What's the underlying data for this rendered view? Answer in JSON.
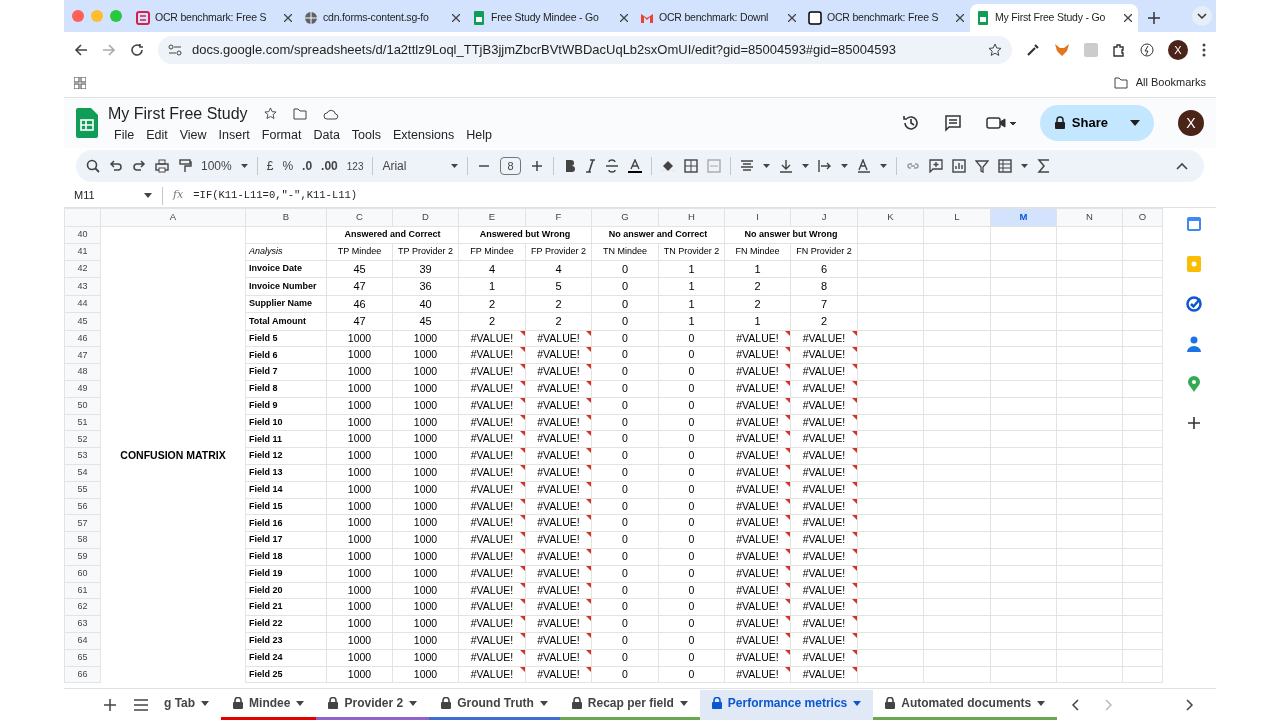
{
  "browser_tabs": [
    {
      "title": "OCR benchmark: Free S",
      "kind": "form",
      "selected": false
    },
    {
      "title": "cdn.forms-content.sg-fo",
      "kind": "web",
      "selected": false
    },
    {
      "title": "Free Study Mindee - Go",
      "kind": "sheets",
      "selected": false
    },
    {
      "title": "OCR benchmark: Downl",
      "kind": "gmail",
      "selected": false
    },
    {
      "title": "OCR benchmark: Free S",
      "kind": "notion",
      "selected": false
    },
    {
      "title": "My First Free Study - Go",
      "kind": "sheets",
      "selected": true
    }
  ],
  "address": "docs.google.com/spreadsheets/d/1a2ttlz9Loql_TTjB3jjmZbcrBVtWBDacUqLb2sxOmUI/edit?gid=85004593#gid=85004593",
  "profile_initial": "X",
  "bookmarks": {
    "label": "All Bookmarks"
  },
  "document": {
    "title": "My First Free Study",
    "menus": [
      "File",
      "Edit",
      "View",
      "Insert",
      "Format",
      "Data",
      "Tools",
      "Extensions",
      "Help"
    ],
    "share_label": "Share",
    "avatar_initial": "X"
  },
  "toolbar": {
    "zoom": "100%",
    "currency": "£",
    "percent": "%",
    "decrease_decimals": ".0",
    "increase_decimals": ".00",
    "number_format": "123",
    "font": "Arial",
    "font_size": "8"
  },
  "formula_bar": {
    "cell": "M11",
    "fx": "fx",
    "formula": "=IF(K11-L11=0,\"-\",K11-L11)"
  },
  "sheet": {
    "columns": [
      {
        "label": "A",
        "selected": false
      },
      {
        "label": "B",
        "selected": false
      },
      {
        "label": "C",
        "selected": false
      },
      {
        "label": "D",
        "selected": false
      },
      {
        "label": "E",
        "selected": false
      },
      {
        "label": "F",
        "selected": false
      },
      {
        "label": "G",
        "selected": false
      },
      {
        "label": "H",
        "selected": false
      },
      {
        "label": "I",
        "selected": false
      },
      {
        "label": "J",
        "selected": false
      },
      {
        "label": "K",
        "selected": false
      },
      {
        "label": "L",
        "selected": false
      },
      {
        "label": "M",
        "selected": true
      },
      {
        "label": "N",
        "selected": false
      },
      {
        "label": "O",
        "selected": false
      }
    ],
    "rows": [
      {
        "number": "40",
        "kind": "group",
        "cells": [
          "",
          "",
          {
            "text": "Answered and Correct",
            "colspan": 2
          },
          {
            "text": "Answered but Wrong",
            "colspan": 2
          },
          {
            "text": "No answer and Correct",
            "colspan": 2
          },
          {
            "text": "No answer but Wrong",
            "colspan": 2
          }
        ]
      },
      {
        "number": "41",
        "kind": "subheader",
        "cells": [
          "",
          "Analysis",
          "TP Mindee",
          "TP Provider 2",
          "FP Mindee",
          "FP Provider 2",
          "TN Mindee",
          "TN Provider 2",
          "FN Mindee",
          "FN Provider 2"
        ]
      },
      {
        "number": "42",
        "kind": "main",
        "cells": [
          "",
          "Invoice Date",
          "45",
          "39",
          "4",
          "4",
          "0",
          "1",
          "1",
          "6"
        ]
      },
      {
        "number": "43",
        "kind": "main",
        "cells": [
          "",
          "Invoice Number",
          "47",
          "36",
          "1",
          "5",
          "0",
          "1",
          "2",
          "8"
        ]
      },
      {
        "number": "44",
        "kind": "main",
        "cells": [
          "",
          "Supplier Name",
          "46",
          "40",
          "2",
          "2",
          "0",
          "1",
          "2",
          "7"
        ]
      },
      {
        "number": "45",
        "kind": "main",
        "cells": [
          "",
          "Total Amount",
          "47",
          "45",
          "2",
          "2",
          "0",
          "1",
          "1",
          "2"
        ]
      },
      {
        "number": "46",
        "kind": "field",
        "cells": [
          "",
          "Field 5",
          "1000",
          "1000",
          "#VALUE!",
          "#VALUE!",
          "0",
          "0",
          "#VALUE!",
          "#VALUE!"
        ],
        "errors": [
          false,
          false,
          false,
          false,
          true,
          true,
          false,
          false,
          true,
          true
        ]
      },
      {
        "number": "47",
        "kind": "field",
        "cells": [
          "",
          "Field 6",
          "1000",
          "1000",
          "#VALUE!",
          "#VALUE!",
          "0",
          "0",
          "#VALUE!",
          "#VALUE!"
        ],
        "errors": [
          false,
          false,
          false,
          false,
          true,
          true,
          false,
          false,
          true,
          true
        ]
      },
      {
        "number": "48",
        "kind": "field",
        "cells": [
          "",
          "Field 7",
          "1000",
          "1000",
          "#VALUE!",
          "#VALUE!",
          "0",
          "0",
          "#VALUE!",
          "#VALUE!"
        ],
        "errors": [
          false,
          false,
          false,
          false,
          true,
          true,
          false,
          false,
          true,
          true
        ]
      },
      {
        "number": "49",
        "kind": "field",
        "cells": [
          "",
          "Field 8",
          "1000",
          "1000",
          "#VALUE!",
          "#VALUE!",
          "0",
          "0",
          "#VALUE!",
          "#VALUE!"
        ],
        "errors": [
          false,
          false,
          false,
          false,
          true,
          true,
          false,
          false,
          true,
          true
        ]
      },
      {
        "number": "50",
        "kind": "field",
        "cells": [
          "",
          "Field 9",
          "1000",
          "1000",
          "#VALUE!",
          "#VALUE!",
          "0",
          "0",
          "#VALUE!",
          "#VALUE!"
        ],
        "errors": [
          false,
          false,
          false,
          false,
          true,
          true,
          false,
          false,
          true,
          true
        ]
      },
      {
        "number": "51",
        "kind": "field",
        "cells": [
          "",
          "Field 10",
          "1000",
          "1000",
          "#VALUE!",
          "#VALUE!",
          "0",
          "0",
          "#VALUE!",
          "#VALUE!"
        ],
        "errors": [
          false,
          false,
          false,
          false,
          true,
          true,
          false,
          false,
          true,
          true
        ]
      },
      {
        "number": "52",
        "kind": "field",
        "cells": [
          "",
          "Field 11",
          "1000",
          "1000",
          "#VALUE!",
          "#VALUE!",
          "0",
          "0",
          "#VALUE!",
          "#VALUE!"
        ],
        "errors": [
          false,
          false,
          false,
          false,
          true,
          true,
          false,
          false,
          true,
          true
        ]
      },
      {
        "number": "53",
        "kind": "field",
        "cells": [
          "CONFUSION MATRIX",
          "Field 12",
          "1000",
          "1000",
          "#VALUE!",
          "#VALUE!",
          "0",
          "0",
          "#VALUE!",
          "#VALUE!"
        ],
        "errors": [
          false,
          false,
          false,
          false,
          true,
          true,
          false,
          false,
          true,
          true
        ]
      },
      {
        "number": "54",
        "kind": "field",
        "cells": [
          "",
          "Field 13",
          "1000",
          "1000",
          "#VALUE!",
          "#VALUE!",
          "0",
          "0",
          "#VALUE!",
          "#VALUE!"
        ],
        "errors": [
          false,
          false,
          false,
          false,
          true,
          true,
          false,
          false,
          true,
          true
        ]
      },
      {
        "number": "55",
        "kind": "field",
        "cells": [
          "",
          "Field 14",
          "1000",
          "1000",
          "#VALUE!",
          "#VALUE!",
          "0",
          "0",
          "#VALUE!",
          "#VALUE!"
        ],
        "errors": [
          false,
          false,
          false,
          false,
          true,
          true,
          false,
          false,
          true,
          true
        ]
      },
      {
        "number": "56",
        "kind": "field",
        "cells": [
          "",
          "Field 15",
          "1000",
          "1000",
          "#VALUE!",
          "#VALUE!",
          "0",
          "0",
          "#VALUE!",
          "#VALUE!"
        ],
        "errors": [
          false,
          false,
          false,
          false,
          true,
          true,
          false,
          false,
          true,
          true
        ]
      },
      {
        "number": "57",
        "kind": "field",
        "cells": [
          "",
          "Field 16",
          "1000",
          "1000",
          "#VALUE!",
          "#VALUE!",
          "0",
          "0",
          "#VALUE!",
          "#VALUE!"
        ],
        "errors": [
          false,
          false,
          false,
          false,
          true,
          true,
          false,
          false,
          true,
          true
        ]
      },
      {
        "number": "58",
        "kind": "field",
        "cells": [
          "",
          "Field 17",
          "1000",
          "1000",
          "#VALUE!",
          "#VALUE!",
          "0",
          "0",
          "#VALUE!",
          "#VALUE!"
        ],
        "errors": [
          false,
          false,
          false,
          false,
          true,
          true,
          false,
          false,
          true,
          true
        ]
      },
      {
        "number": "59",
        "kind": "field",
        "cells": [
          "",
          "Field 18",
          "1000",
          "1000",
          "#VALUE!",
          "#VALUE!",
          "0",
          "0",
          "#VALUE!",
          "#VALUE!"
        ],
        "errors": [
          false,
          false,
          false,
          false,
          true,
          true,
          false,
          false,
          true,
          true
        ]
      },
      {
        "number": "60",
        "kind": "field",
        "cells": [
          "",
          "Field 19",
          "1000",
          "1000",
          "#VALUE!",
          "#VALUE!",
          "0",
          "0",
          "#VALUE!",
          "#VALUE!"
        ],
        "errors": [
          false,
          false,
          false,
          false,
          true,
          true,
          false,
          false,
          true,
          true
        ]
      },
      {
        "number": "61",
        "kind": "field",
        "cells": [
          "",
          "Field 20",
          "1000",
          "1000",
          "#VALUE!",
          "#VALUE!",
          "0",
          "0",
          "#VALUE!",
          "#VALUE!"
        ],
        "errors": [
          false,
          false,
          false,
          false,
          true,
          true,
          false,
          false,
          true,
          true
        ]
      },
      {
        "number": "62",
        "kind": "field",
        "cells": [
          "",
          "Field 21",
          "1000",
          "1000",
          "#VALUE!",
          "#VALUE!",
          "0",
          "0",
          "#VALUE!",
          "#VALUE!"
        ],
        "errors": [
          false,
          false,
          false,
          false,
          true,
          true,
          false,
          false,
          true,
          true
        ]
      },
      {
        "number": "63",
        "kind": "field",
        "cells": [
          "",
          "Field 22",
          "1000",
          "1000",
          "#VALUE!",
          "#VALUE!",
          "0",
          "0",
          "#VALUE!",
          "#VALUE!"
        ],
        "errors": [
          false,
          false,
          false,
          false,
          true,
          true,
          false,
          false,
          true,
          true
        ]
      },
      {
        "number": "64",
        "kind": "field",
        "cells": [
          "",
          "Field 23",
          "1000",
          "1000",
          "#VALUE!",
          "#VALUE!",
          "0",
          "0",
          "#VALUE!",
          "#VALUE!"
        ],
        "errors": [
          false,
          false,
          false,
          false,
          true,
          true,
          false,
          false,
          true,
          true
        ]
      },
      {
        "number": "65",
        "kind": "field",
        "cells": [
          "",
          "Field 24",
          "1000",
          "1000",
          "#VALUE!",
          "#VALUE!",
          "0",
          "0",
          "#VALUE!",
          "#VALUE!"
        ],
        "errors": [
          false,
          false,
          false,
          false,
          true,
          true,
          false,
          false,
          true,
          true
        ]
      },
      {
        "number": "66",
        "kind": "field",
        "cells": [
          "",
          "Field 25",
          "1000",
          "1000",
          "#VALUE!",
          "#VALUE!",
          "0",
          "0",
          "#VALUE!",
          "#VALUE!"
        ],
        "errors": [
          false,
          false,
          false,
          false,
          true,
          true,
          false,
          false,
          true,
          true
        ]
      }
    ]
  },
  "sheet_tabs": [
    {
      "label": "g Tab",
      "locked": false,
      "selected": false
    },
    {
      "label": "Mindee",
      "locked": true,
      "color": "#e50000",
      "selected": false
    },
    {
      "label": "Provider 2",
      "locked": true,
      "color": "#8e63ce",
      "selected": false
    },
    {
      "label": "Ground Truth",
      "locked": true,
      "color": "#3d6fd1",
      "selected": false
    },
    {
      "label": "Recap per field",
      "locked": true,
      "color": "#6aa84f",
      "selected": false
    },
    {
      "label": "Performance metrics",
      "locked": true,
      "selected": true
    },
    {
      "label": "Automated documents",
      "locked": true,
      "color": "#6aa84f",
      "selected": false
    }
  ]
}
